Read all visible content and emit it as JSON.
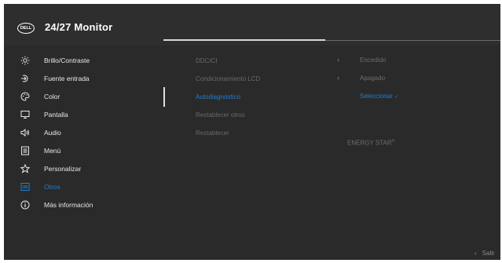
{
  "header": {
    "logo_text": "DELL",
    "title": "24/27 Monitor"
  },
  "menu": [
    {
      "label": "Brillo/Contraste",
      "icon": "brightness-icon"
    },
    {
      "label": "Fuente entrada",
      "icon": "input-source-icon"
    },
    {
      "label": "Color",
      "icon": "color-palette-icon"
    },
    {
      "label": "Pantalla",
      "icon": "display-icon"
    },
    {
      "label": "Audio",
      "icon": "speaker-icon"
    },
    {
      "label": "Menú",
      "icon": "menu-icon"
    },
    {
      "label": "Personalizar",
      "icon": "star-icon"
    },
    {
      "label": "Otros",
      "icon": "others-icon",
      "active": true
    },
    {
      "label": "Más información",
      "icon": "info-icon"
    }
  ],
  "submenu": [
    {
      "label": "DDC/CI",
      "value": "Encedido",
      "has_chevron": true
    },
    {
      "label": "Condicionamiento LCD",
      "value": "Apagado",
      "has_chevron": true
    },
    {
      "label": "Autodiagnóstico",
      "value": "Seleccionar",
      "active": true
    },
    {
      "label": "Restablecer otros"
    },
    {
      "label": "Restablecer"
    }
  ],
  "energy_star": {
    "text": "ENERGY STAR",
    "mark": "®"
  },
  "footer": {
    "exit_label": "Salir"
  },
  "colors": {
    "accent": "#1e7ed6",
    "background": "#2a2a2a",
    "text": "#e8e8e8",
    "muted": "#6a6a6a"
  }
}
